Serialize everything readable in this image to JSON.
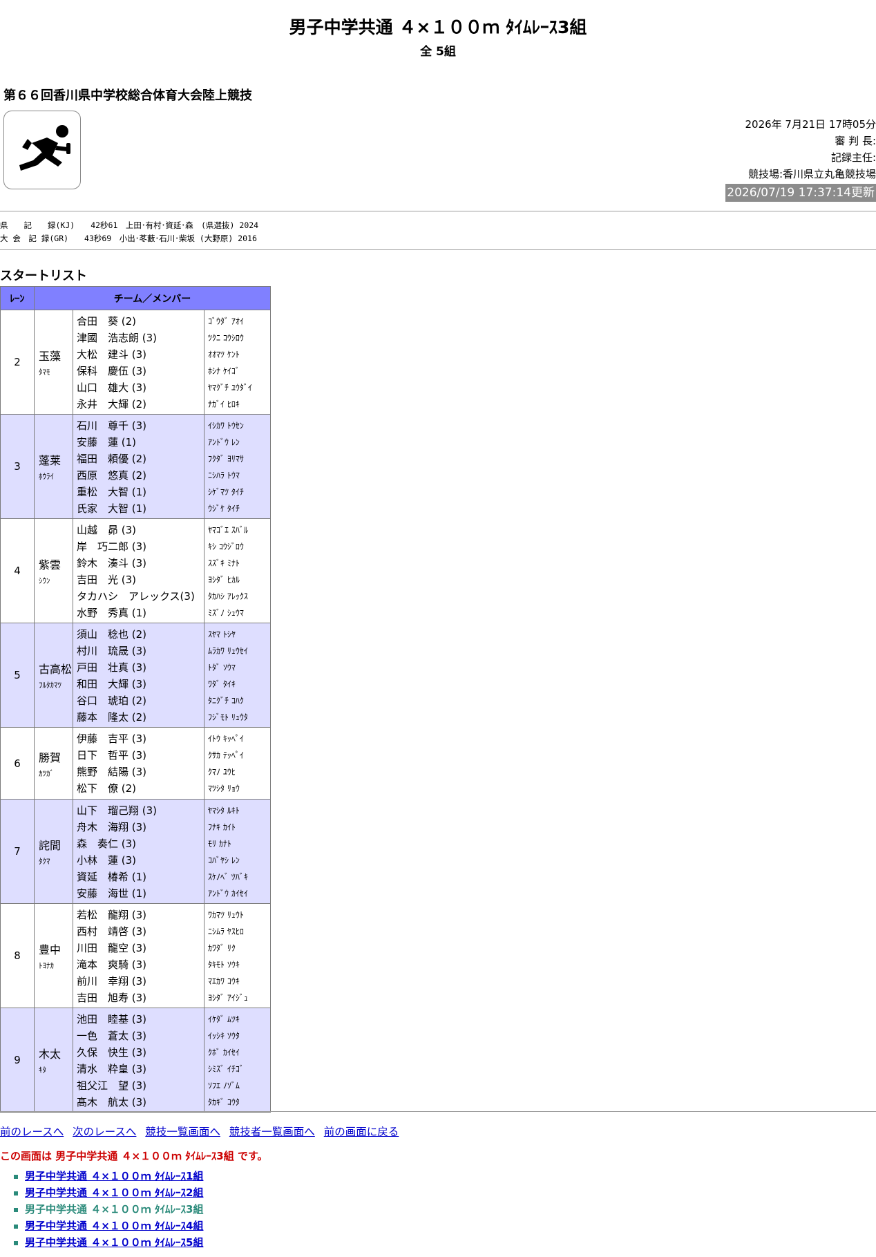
{
  "header": {
    "title": "男子中学共通 ４×１００ｍ ﾀｲﾑﾚｰｽ3組",
    "subtitle": "全 5組",
    "meet_name": "第６６回香川県中学校総合体育大会陸上競技",
    "logo_icon": "relay-runner-icon"
  },
  "meta": {
    "datetime": "2026年 7月21日 17時05分",
    "referee": "審 判 長:",
    "recorder": "記録主任:",
    "venue": "競技場:香川県立丸亀競技場",
    "updated": "2026/07/19 17:37:14更新"
  },
  "records": {
    "kj": "県　　記　　録(KJ)　　42秒61　上田･有村･資延･森　(県選抜) 2024",
    "gr": "大 会　記 録(GR)　　43秒69　小出･苳藪･石川･柴坂 (大野原) 2016"
  },
  "startlist": {
    "heading": "スタートリスト",
    "col_lane": "ﾚｰﾝ",
    "col_team": "チーム／メンバー",
    "rows": [
      {
        "lane": "2",
        "team": "玉藻",
        "team_kana": "ﾀﾏﾓ",
        "members": [
          "合田　葵 (2)",
          "津國　浩志朗 (3)",
          "大松　建斗 (3)",
          "保科　慶伍 (3)",
          "山口　雄大 (3)",
          "永井　大輝 (2)"
        ],
        "kanas": [
          "ｺﾞｳﾀﾞ ｱｵｲ",
          "ﾂｸﾆ ｺｳｼﾛｳ",
          "ｵｵﾏﾂ ｹﾝﾄ",
          "ﾎｼﾅ ｹｲｺﾞ",
          "ﾔﾏｸﾞﾁ ﾕｳﾀﾞｲ",
          "ﾅｶﾞｲ ﾋﾛｷ"
        ]
      },
      {
        "lane": "3",
        "team": "蓬莱",
        "team_kana": "ﾎｳﾗｲ",
        "members": [
          "石川　尊千 (3)",
          "安藤　蓮 (1)",
          "福田　頼優 (2)",
          "西原　悠真 (2)",
          "重松　大智 (1)",
          "氏家　大智 (1)"
        ],
        "kanas": [
          "ｲｼｶﾜ ﾄｳｾﾝ",
          "ｱﾝﾄﾞｳ ﾚﾝ",
          "ﾌｸﾀﾞ ﾖﾘﾏｻ",
          "ﾆｼﾊﾗ ﾄｳﾏ",
          "ｼｹﾞﾏﾂ ﾀｲﾁ",
          "ｳｼﾞｹ ﾀｲﾁ"
        ]
      },
      {
        "lane": "4",
        "team": "紫雲",
        "team_kana": "ｼｳﾝ",
        "members": [
          "山越　昴 (3)",
          "岸　巧二郎 (3)",
          "鈴木　湊斗 (3)",
          "吉田　光 (3)",
          "タカハシ　アレックス(3)",
          "水野　秀真 (1)"
        ],
        "kanas": [
          "ﾔﾏｺﾞｴ ｽﾊﾞﾙ",
          "ｷｼ ｺｳｼﾞﾛｳ",
          "ｽｽﾞｷ ﾐﾅﾄ",
          "ﾖｼﾀﾞ ﾋｶﾙ",
          "ﾀｶﾊｼ ｱﾚｯｸｽ",
          "ﾐｽﾞﾉ ｼｭｳﾏ"
        ]
      },
      {
        "lane": "5",
        "team": "古高松",
        "team_kana": "ﾌﾙﾀｶﾏﾂ",
        "members": [
          "須山　稔也 (2)",
          "村川　琉晟 (3)",
          "戸田　壮真 (3)",
          "和田　大輝 (3)",
          "谷口　琥珀 (2)",
          "藤本　隆太 (2)"
        ],
        "kanas": [
          "ｽﾔﾏ ﾄｼﾔ",
          "ﾑﾗｶﾜ ﾘｭｳｾｲ",
          "ﾄﾀﾞ ｿｳﾏ",
          "ﾜﾀﾞ ﾀｲｷ",
          "ﾀﾆｸﾞﾁ ｺﾊｸ",
          "ﾌｼﾞﾓﾄ ﾘｭｳﾀ"
        ]
      },
      {
        "lane": "6",
        "team": "勝賀",
        "team_kana": "ｶﾂｶﾞ",
        "members": [
          "伊藤　吉平 (3)",
          "日下　哲平 (3)",
          "熊野　結陽 (3)",
          "松下　僚 (2)"
        ],
        "kanas": [
          "ｲﾄｳ ｷｯﾍﾟｲ",
          "ｸｻｶ ﾃｯﾍﾟｲ",
          "ｸﾏﾉ ﾕｳﾋ",
          "ﾏﾂｼﾀ ﾘｮｳ"
        ]
      },
      {
        "lane": "7",
        "team": "詫間",
        "team_kana": "ﾀｸﾏ",
        "members": [
          "山下　瑠己翔 (3)",
          "舟木　海翔 (3)",
          "森　奏仁 (3)",
          "小林　蓮 (3)",
          "資延　椿希 (1)",
          "安藤　海世 (1)"
        ],
        "kanas": [
          "ﾔﾏｼﾀ ﾙｷﾄ",
          "ﾌﾅｷ ｶｲﾄ",
          "ﾓﾘ ｶﾅﾄ",
          "ｺﾊﾞﾔｼ ﾚﾝ",
          "ｽｹﾉﾍﾞ ﾂﾊﾞｷ",
          "ｱﾝﾄﾞｳ ｶｲｾｲ"
        ]
      },
      {
        "lane": "8",
        "team": "豊中",
        "team_kana": "ﾄﾖﾅｶ",
        "members": [
          "若松　龍翔 (3)",
          "西村　靖啓 (3)",
          "川田　龍空 (3)",
          "滝本　爽騎 (3)",
          "前川　幸翔 (3)",
          "吉田　旭寿 (3)"
        ],
        "kanas": [
          "ﾜｶﾏﾂ ﾘｭｳﾄ",
          "ﾆｼﾑﾗ ﾔｽﾋﾛ",
          "ｶﾜﾀﾞ ﾘｸ",
          "ﾀｷﾓﾄ ｿｳｷ",
          "ﾏｴｶﾜ ｺｳｷ",
          "ﾖｼﾀﾞ ｱｲｼﾞｭ"
        ]
      },
      {
        "lane": "9",
        "team": "木太",
        "team_kana": "ｷﾀ",
        "members": [
          "池田　睦基 (3)",
          "一色　蒼太 (3)",
          "久保　快生 (3)",
          "清水　粋皇 (3)",
          "祖父江　望 (3)",
          "髙木　航太 (3)"
        ],
        "kanas": [
          "ｲｹﾀﾞ ﾑﾂｷ",
          "ｲｯｼｷ ｿｳﾀ",
          "ｸﾎﾞ ｶｲｾｲ",
          "ｼﾐｽﾞ ｲﾁｺﾞ",
          "ｿﾌｴ ﾉｿﾞﾑ",
          "ﾀｶｷﾞ ｺｳﾀ"
        ]
      }
    ]
  },
  "nav": {
    "prev_race": "前のレースへ",
    "next_race": "次のレースへ",
    "event_list": "競技一覧画面へ",
    "athlete_list": "競技者一覧画面へ",
    "back": "前の画面に戻る"
  },
  "current": {
    "prefix": "この画面は",
    "race": "男子中学共通 ４×１００ｍ ﾀｲﾑﾚｰｽ3組",
    "suffix": "です。"
  },
  "race_links": [
    "男子中学共通 ４×１００ｍ ﾀｲﾑﾚｰｽ1組",
    "男子中学共通 ４×１００ｍ ﾀｲﾑﾚｰｽ2組",
    "男子中学共通 ４×１００ｍ ﾀｲﾑﾚｰｽ3組",
    "男子中学共通 ４×１００ｍ ﾀｲﾑﾚｰｽ4組",
    "男子中学共通 ４×１００ｍ ﾀｲﾑﾚｰｽ5組"
  ],
  "current_link_index": 2
}
